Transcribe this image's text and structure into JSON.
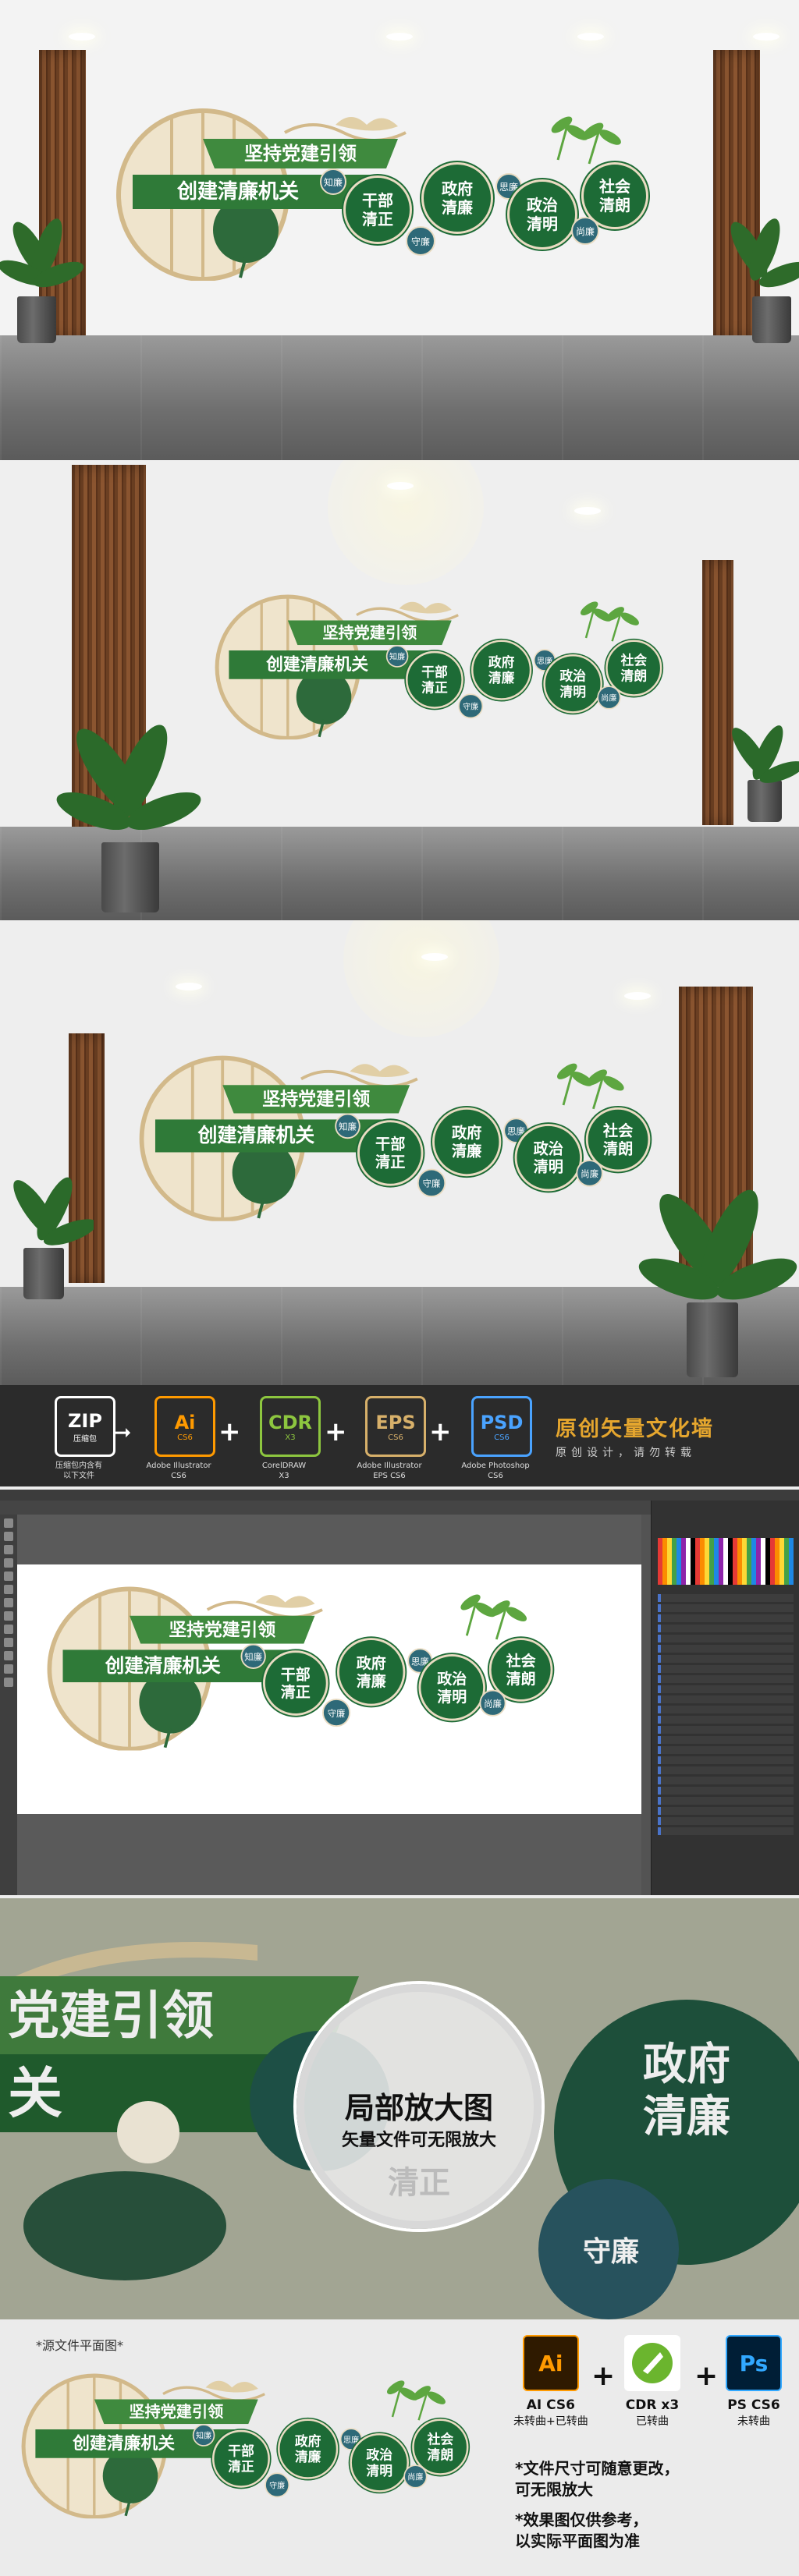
{
  "design": {
    "title_top": "坚持党建引领",
    "title_main": "创建清廉机关",
    "bubbles": [
      {
        "text": "干部\n清正",
        "tag": "知廉"
      },
      {
        "text": "政府\n清廉",
        "tag": "守廉"
      },
      {
        "text": "政治\n清明",
        "tag": "思廉"
      },
      {
        "text": "社会\n清朗",
        "tag": "尚廉"
      }
    ]
  },
  "banner": {
    "title": "原创矢量文化墙",
    "subtitle": "原创设计，请勿转载",
    "formats": [
      {
        "name": "ZIP",
        "version": "压缩包",
        "caption": "压缩包内含有\n以下文件",
        "color": "#ffffff"
      },
      {
        "name": "Ai",
        "version": "CS6",
        "caption": "Adobe Illustrator\nCS6",
        "color": "#ff9a00"
      },
      {
        "name": "CDR",
        "version": "X3",
        "caption": "CorelDRAW\nX3",
        "color": "#8dc63f"
      },
      {
        "name": "EPS",
        "version": "CS6",
        "caption": "Adobe Illustrator\nEPS CS6",
        "color": "#d7b06a"
      },
      {
        "name": "PSD",
        "version": "CS6",
        "caption": "Adobe Photoshop\nCS6",
        "color": "#4aa3ff"
      }
    ]
  },
  "zoom": {
    "title": "局部放大图",
    "subtitle": "矢量文件可无限放大",
    "bg_words": [
      "党建引领",
      "关",
      "政府\n清廉",
      "清正",
      "守廉"
    ]
  },
  "bottom": {
    "plan_label": "*源文件平面图*",
    "software": [
      {
        "icon": "Ai",
        "name": "AI CS6",
        "note": "未转曲+已转曲",
        "color": "#ff9a00",
        "bg": "#2f1a00"
      },
      {
        "icon": "",
        "name": "CDR x3",
        "note": "已转曲",
        "color": "#8dc63f",
        "bg": "#ffffff"
      },
      {
        "icon": "Ps",
        "name": "PS CS6",
        "note": "未转曲",
        "color": "#31a8ff",
        "bg": "#001e36"
      }
    ],
    "notes": [
      "*文件尺寸可随意更改，\n  可无限放大",
      "*效果图仅供参考，\n  以实际平面图为准"
    ]
  }
}
